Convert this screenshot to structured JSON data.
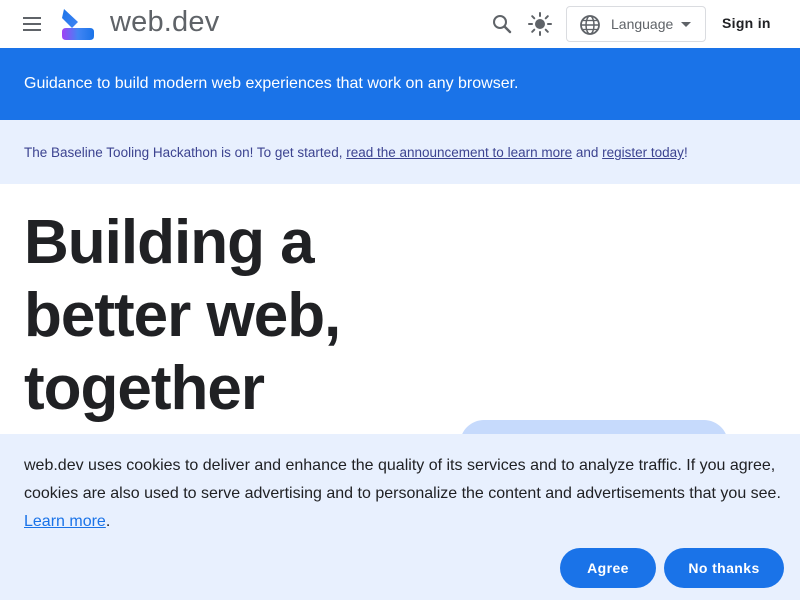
{
  "header": {
    "menu_icon": "hamburger-menu-icon",
    "logo_icon": "web-dev-logo",
    "logo_text": "web.dev",
    "search_icon": "search-icon",
    "theme_icon": "sun-theme-icon",
    "language_icon": "globe-icon",
    "language_label": "Language",
    "sign_in_label": "Sign in"
  },
  "hero_banner": {
    "tagline": "Guidance to build modern web experiences that work on any browser."
  },
  "announcement": {
    "prefix": "The Baseline Tooling Hackathon is on! To get started, ",
    "link1": "read the announcement to learn more",
    "middle": " and ",
    "link2": "register today",
    "suffix": "!"
  },
  "main": {
    "headline_line1": "Building a",
    "headline_line2": "better web,",
    "headline_line3": "together"
  },
  "cookie_banner": {
    "message": "web.dev uses cookies to deliver and enhance the quality of its services and to analyze traffic. If you agree, cookies are also used to serve advertising and to personalize the content and advertisements that you see. ",
    "learn_more": "Learn more",
    "period": ".",
    "agree_label": "Agree",
    "no_thanks_label": "No thanks"
  },
  "colors": {
    "brand_blue": "#1a73e8",
    "banner_light": "#e8f0fe",
    "text_dark": "#202124"
  }
}
